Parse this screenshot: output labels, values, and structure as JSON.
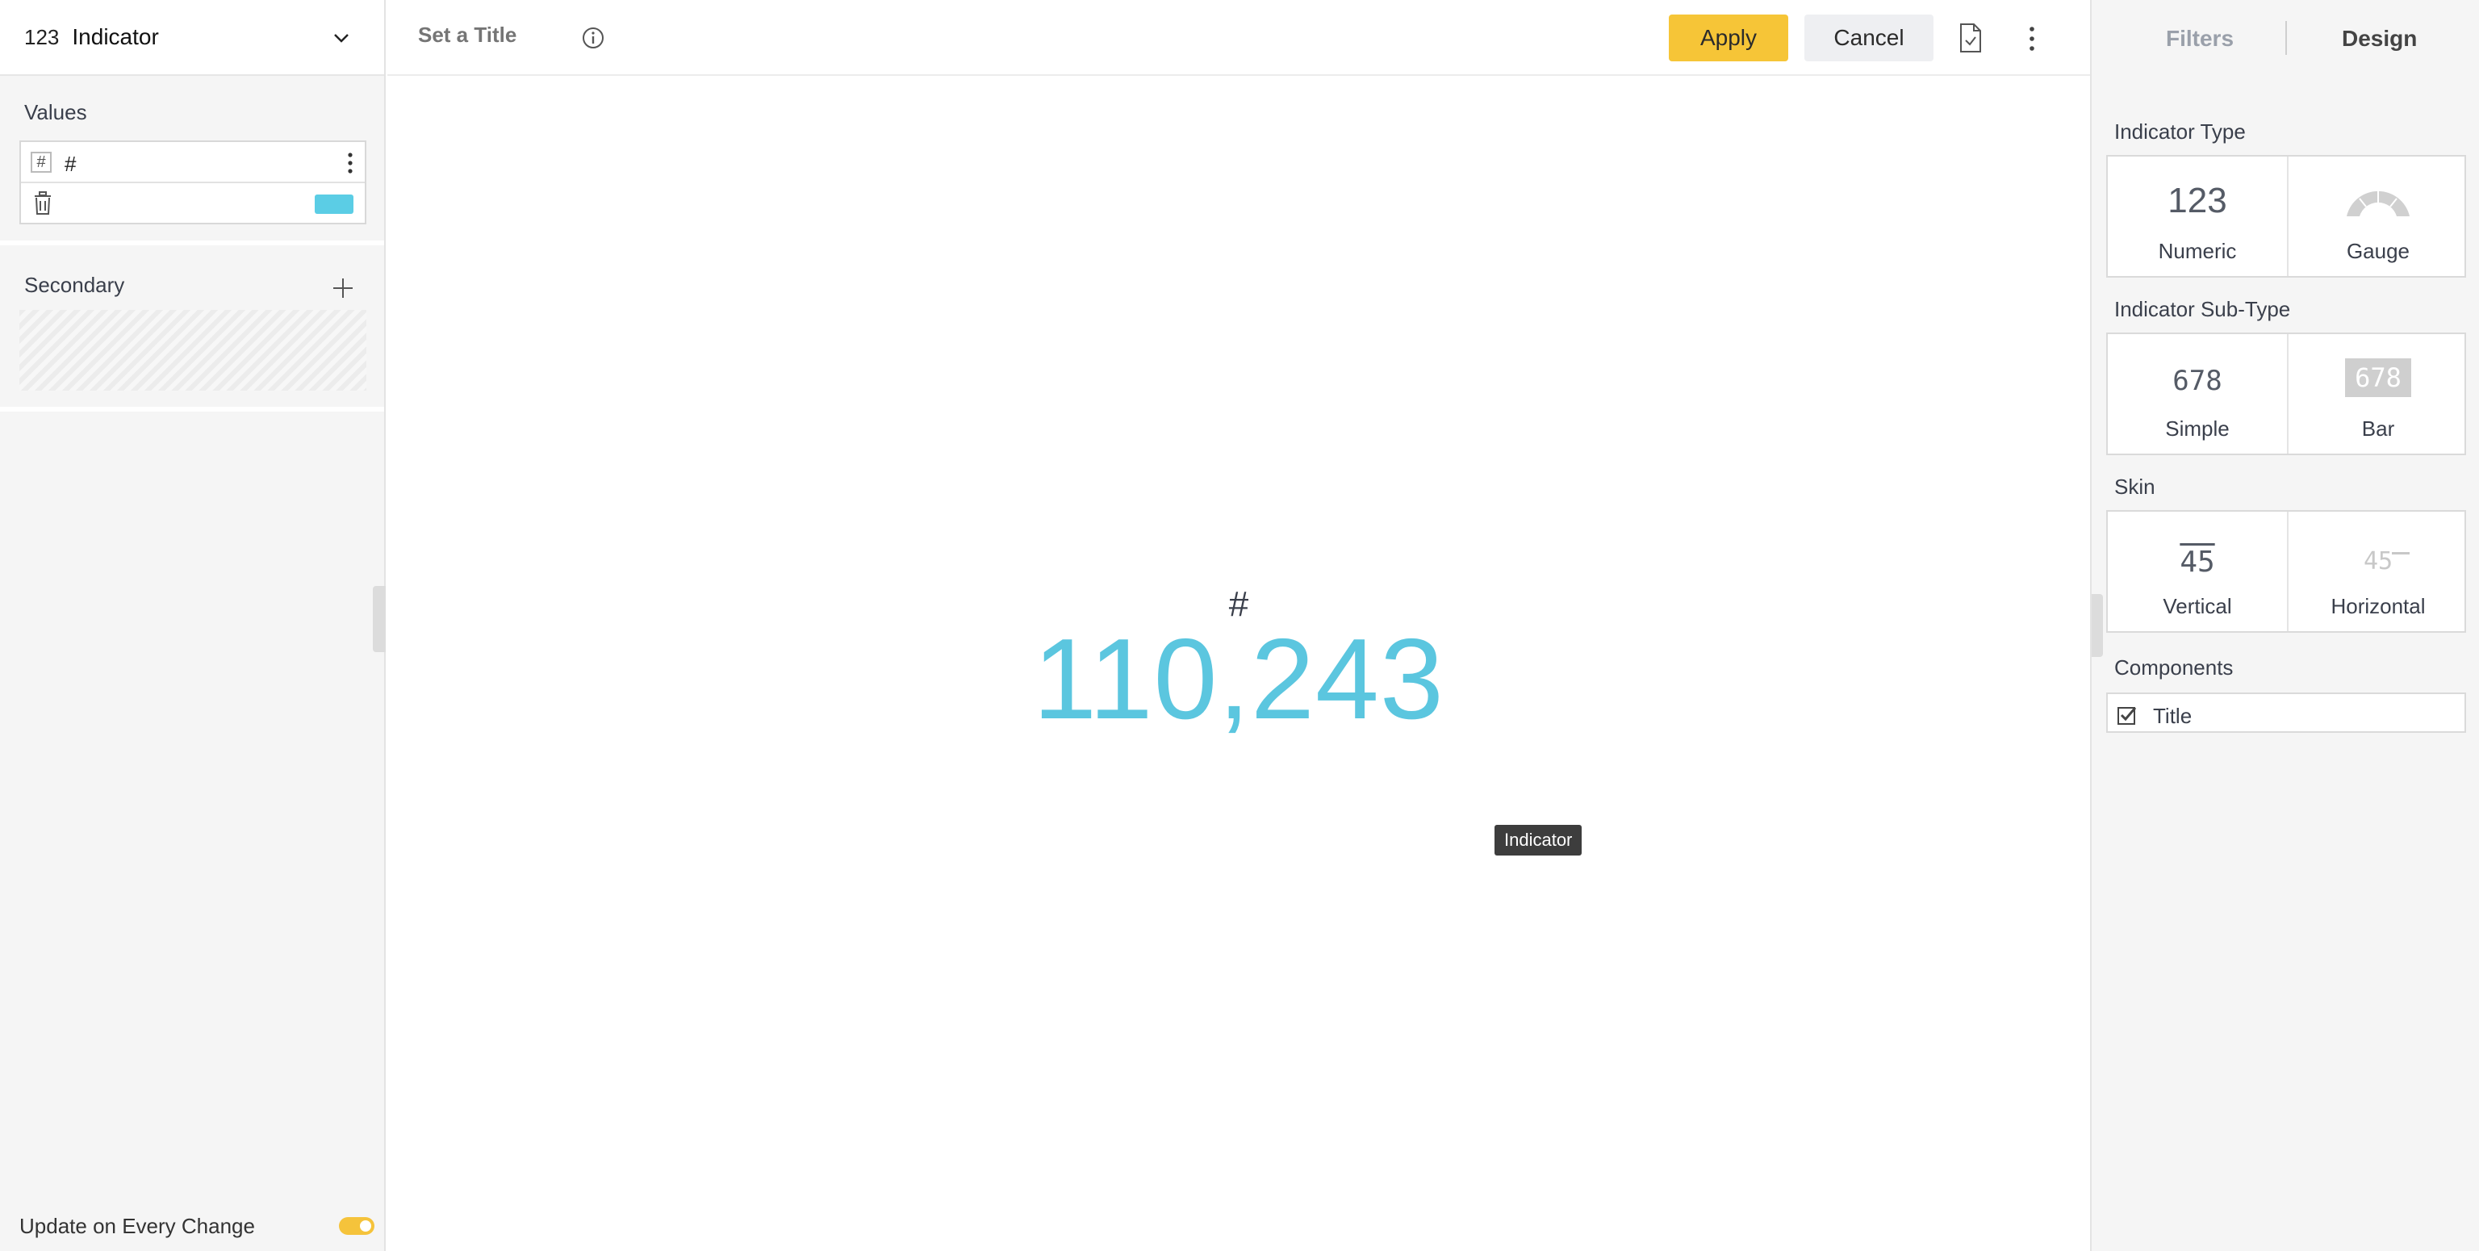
{
  "left_panel": {
    "widget_selector": {
      "icon_text": "123",
      "label": "Indicator"
    },
    "values": {
      "title": "Values",
      "items": [
        {
          "badge": "#",
          "name": "#",
          "color": "#5bcde5"
        }
      ]
    },
    "secondary": {
      "title": "Secondary"
    },
    "update_on_change": {
      "label": "Update on Every Change",
      "enabled": true
    }
  },
  "topbar": {
    "title_placeholder": "Set a Title",
    "apply_label": "Apply",
    "cancel_label": "Cancel"
  },
  "canvas": {
    "indicator_label": "#",
    "indicator_value": "110,243",
    "value_color": "#5bc6df",
    "tooltip": "Indicator"
  },
  "right_panel": {
    "tabs": [
      {
        "label": "Filters",
        "active": false
      },
      {
        "label": "Design",
        "active": true
      }
    ],
    "indicator_type": {
      "title": "Indicator Type",
      "options": [
        {
          "glyph": "123",
          "label": "Numeric"
        },
        {
          "glyph": "gauge-icon",
          "label": "Gauge"
        }
      ]
    },
    "indicator_subtype": {
      "title": "Indicator Sub-Type",
      "options": [
        {
          "glyph": "678",
          "label": "Simple"
        },
        {
          "glyph": "678",
          "label": "Bar"
        }
      ]
    },
    "skin": {
      "title": "Skin",
      "options": [
        {
          "glyph": "45",
          "label": "Vertical"
        },
        {
          "glyph": "45",
          "label": "Horizontal"
        }
      ]
    },
    "components": {
      "title": "Components",
      "items": [
        {
          "label": "Title",
          "checked": true
        }
      ]
    }
  },
  "colors": {
    "accent_yellow": "#f6c537",
    "value_blue": "#5bc6df"
  }
}
